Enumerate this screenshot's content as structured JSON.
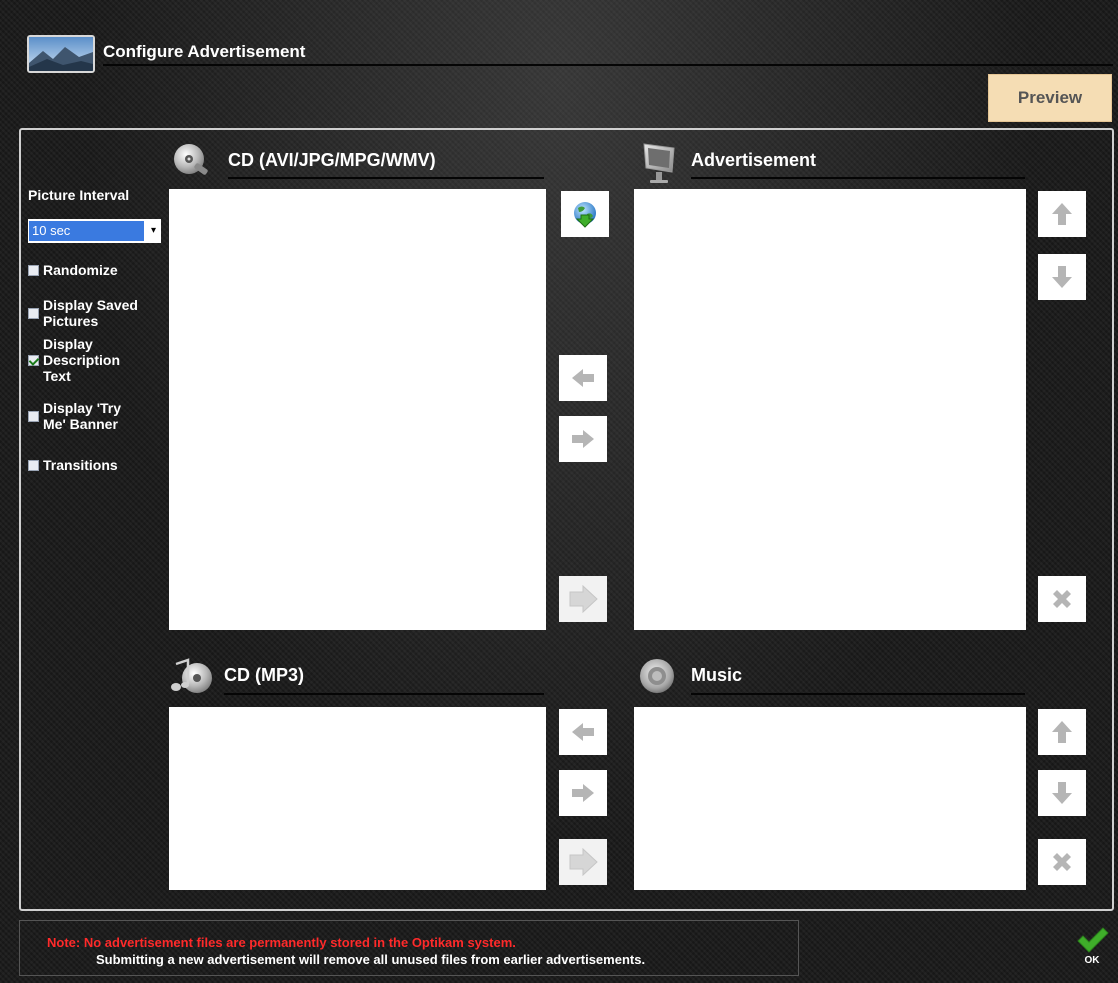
{
  "header": {
    "title": "Configure Advertisement",
    "preview_label": "Preview"
  },
  "options": {
    "picture_interval_label": "Picture Interval",
    "interval_value": "10 sec",
    "randomize": {
      "label": "Randomize",
      "checked": false
    },
    "display_saved_pictures": {
      "label1": "Display Saved",
      "label2": "Pictures",
      "checked": false
    },
    "display_description_text": {
      "label1": "Display",
      "label2": "Description",
      "label3": "Text",
      "checked": true
    },
    "display_try_me_banner": {
      "label1": "Display 'Try",
      "label2": "Me' Banner",
      "checked": false
    },
    "transitions": {
      "label": "Transitions",
      "checked": false
    }
  },
  "sections": {
    "cd_media": {
      "title": "CD (AVI/JPG/MPG/WMV)",
      "icon": "cd-icon"
    },
    "advertisement": {
      "title": "Advertisement",
      "icon": "monitor-icon"
    },
    "cd_mp3": {
      "title": "CD (MP3)",
      "icon": "music-cd-icon"
    },
    "music": {
      "title": "Music",
      "icon": "speaker-icon"
    }
  },
  "note": {
    "line1": "Note:  No advertisement files are permanently stored in the Optikam system.",
    "line2": "Submitting a new advertisement will remove all unused files from earlier advertisements."
  },
  "ok_label": "OK",
  "colors": {
    "accent_select": "#3a7ae0",
    "preview_bg": "#f5ddb4",
    "note_red": "#ff2a2a",
    "ok_green": "#3fae2a"
  }
}
